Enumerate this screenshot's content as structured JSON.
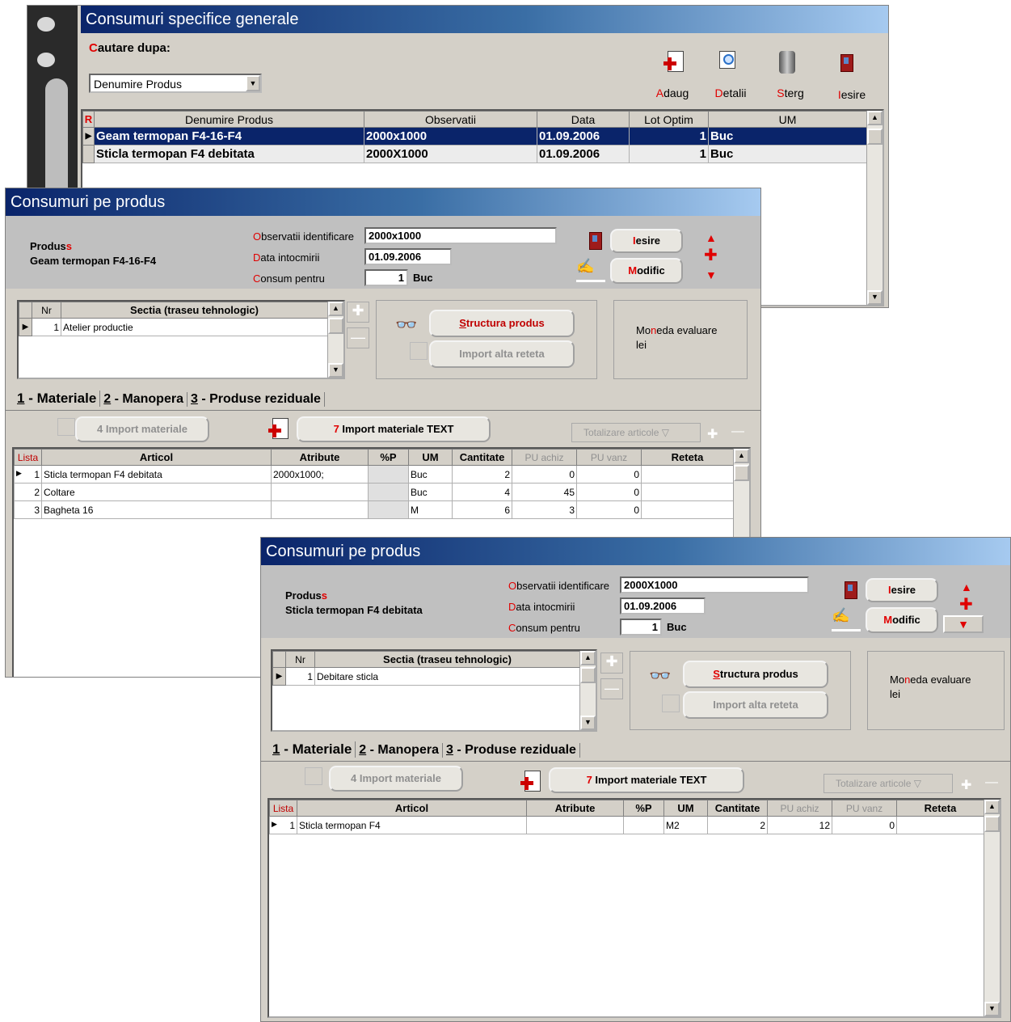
{
  "win1": {
    "title": "Consumuri  specifice generale",
    "search_label_first": "C",
    "search_label_rest": "autare dupa:",
    "search_select_value": "Denumire Produs",
    "toolbar": {
      "add": {
        "hot": "A",
        "rest": "daug"
      },
      "details": {
        "hot": "D",
        "rest": "etalii"
      },
      "delete": {
        "hot": "S",
        "rest": "terg"
      },
      "exit": {
        "hot": "I",
        "rest": "esire"
      }
    },
    "table": {
      "marker": "R",
      "headers": [
        "Denumire Produs",
        "Observatii",
        "Data",
        "Lot Optim",
        "UM"
      ],
      "rows": [
        [
          "Geam termopan F4-16-F4",
          "2000x1000",
          "01.09.2006",
          "1",
          "Buc"
        ],
        [
          "Sticla termopan F4 debitata",
          "2000X1000",
          "01.09.2006",
          "1",
          "Buc"
        ]
      ]
    }
  },
  "win2": {
    "title": "Consumuri pe produs",
    "produs_label": "Produs",
    "produs_label_tail": "s",
    "produs_name": "Geam termopan F4-16-F4",
    "obs_label_hot": "O",
    "obs_label_rest": "bservatii identificare",
    "obs_value": "2000x1000",
    "data_label_hot": "D",
    "data_label_rest": "ata intocmirii",
    "data_value": "01.09.2006",
    "consum_label_hot": "C",
    "consum_label_rest": "onsum pentru",
    "consum_value": "1",
    "consum_unit": "Buc",
    "exit_hot": "I",
    "exit_rest": "esire",
    "modify_hot": "M",
    "modify_rest": "odific",
    "sectia_headers": [
      "Nr",
      "Sectia (traseu tehnologic)"
    ],
    "sectia_rows": [
      [
        "1",
        "Atelier productie"
      ]
    ],
    "structura_hot": "S",
    "structura_mid": "t",
    "structura_rest": "ructura produs",
    "import_reteta": "Import alta reteta",
    "moneda_label_a": "Mo",
    "moneda_label_hot": "n",
    "moneda_label_b": "eda evaluare",
    "moneda_value": "lei",
    "tabs": [
      {
        "num": "1",
        "label": " - Materiale"
      },
      {
        "num": "2",
        "label": " - Manopera"
      },
      {
        "num": "3",
        "label": " - Produse reziduale"
      }
    ],
    "import_materiale": "4 Import materiale",
    "import_text_num": "7",
    "import_text": " Import materiale TEXT",
    "totalizare": "Totalizare articole",
    "mat_headers": [
      "Lista",
      "Articol",
      "Atribute",
      "%P",
      "UM",
      "Cantitate",
      "PU achiz",
      "PU vanz",
      "Reteta"
    ],
    "mat_rows": [
      [
        "1",
        "Sticla termopan F4 debitata",
        "2000x1000;",
        "",
        "Buc",
        "2",
        "0",
        "0",
        ""
      ],
      [
        "2",
        "Coltare",
        "",
        "",
        "Buc",
        "4",
        "45",
        "0",
        ""
      ],
      [
        "3",
        "Bagheta 16",
        "",
        "",
        "M",
        "6",
        "3",
        "0",
        ""
      ]
    ]
  },
  "win3": {
    "title": "Consumuri pe produs",
    "produs_label": "Produs",
    "produs_label_tail": "s",
    "produs_name": "Sticla termopan F4 debitata",
    "obs_label_hot": "O",
    "obs_label_rest": "bservatii identificare",
    "obs_value": "2000X1000",
    "data_label_hot": "D",
    "data_label_rest": "ata intocmirii",
    "data_value": "01.09.2006",
    "consum_label_hot": "C",
    "consum_label_rest": "onsum pentru",
    "consum_value": "1",
    "consum_unit": "Buc",
    "exit_hot": "I",
    "exit_rest": "esire",
    "modify_hot": "M",
    "modify_rest": "odific",
    "sectia_headers": [
      "Nr",
      "Sectia (traseu tehnologic)"
    ],
    "sectia_rows": [
      [
        "1",
        "Debitare sticla"
      ]
    ],
    "structura_hot": "S",
    "structura_mid": "t",
    "structura_rest": "ructura produs",
    "import_reteta": "Import alta reteta",
    "moneda_label_a": "Mo",
    "moneda_label_hot": "n",
    "moneda_label_b": "eda evaluare",
    "moneda_value": "lei",
    "tabs": [
      {
        "num": "1",
        "label": " - Materiale"
      },
      {
        "num": "2",
        "label": " - Manopera"
      },
      {
        "num": "3",
        "label": " - Produse reziduale"
      }
    ],
    "import_materiale": "4 Import materiale",
    "import_text_num": "7",
    "import_text": " Import materiale TEXT",
    "totalizare": "Totalizare articole",
    "mat_headers": [
      "Lista",
      "Articol",
      "Atribute",
      "%P",
      "UM",
      "Cantitate",
      "PU achiz",
      "PU vanz",
      "Reteta"
    ],
    "mat_rows": [
      [
        "1",
        "Sticla termopan F4",
        "",
        "",
        "M2",
        "2",
        "12",
        "0",
        ""
      ]
    ]
  },
  "colors": {
    "title_start": "#0a246a",
    "title_end": "#a6caf0",
    "selected_row": "#0a246a",
    "accent_red": "#e00000",
    "window_bg": "#d4d0c8"
  }
}
